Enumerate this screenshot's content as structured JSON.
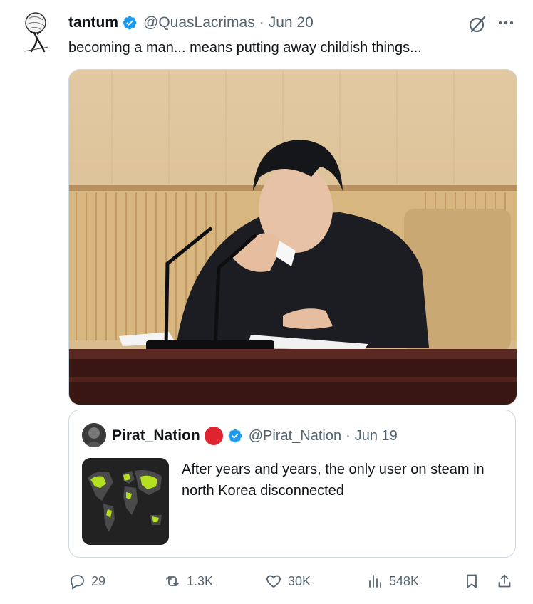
{
  "tweet": {
    "author_name": "tantum",
    "handle": "@QuasLacrimas",
    "separator": "·",
    "date": "Jun 20",
    "text": "becoming a man... means putting away childish things..."
  },
  "quote": {
    "author_name": "Pirat_Nation",
    "handle": "@Pirat_Nation",
    "separator": "·",
    "date": "Jun 19",
    "text": "After years and years, the only user on steam in north Korea disconnected"
  },
  "actions": {
    "replies": "29",
    "reposts": "1.3K",
    "likes": "30K",
    "views": "548K"
  },
  "colors": {
    "verified": "#1d9bf0",
    "secondary_text": "#536471",
    "border": "#cfd9de"
  },
  "icons": [
    "verified-badge-icon",
    "grok-icon",
    "more-icon",
    "reply-icon",
    "repost-icon",
    "like-icon",
    "views-icon",
    "bookmark-icon",
    "share-icon"
  ]
}
